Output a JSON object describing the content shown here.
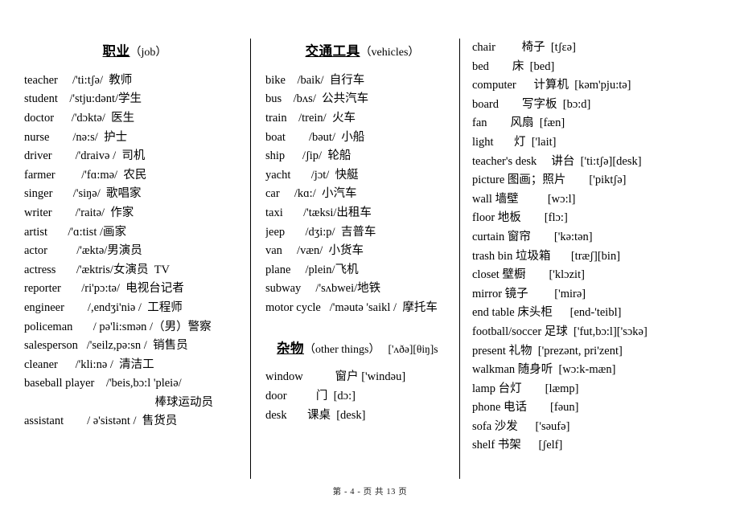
{
  "document": {
    "footer": "第 - 4 - 页 共 13 页"
  },
  "columns": {
    "jobs": {
      "heading_cn": "职业",
      "heading_en": "（job）",
      "entries": [
        "teacher     /'ti:tʃə/  教师",
        "student    /'stju:dənt/学生",
        "doctor      /'dɔktə/  医生",
        "nurse        /nə:s/  护士",
        "driver        /'draivə /  司机",
        "farmer         /'fɑ:mə/  农民",
        "singer       /'siŋə/  歌唱家",
        "writer        /'raitə/  作家",
        "artist       /'ɑ:tist /画家",
        "actor          /'æktə/男演员",
        "actress       /'æktris/女演员  TV",
        "reporter       /ri'pɔ:tə/  电视台记者",
        "engineer        /,endʒi'niə /  工程师",
        "policeman       / pə'li:smən /（男）警察",
        "salesperson   /'seilz,pə:sn /  销售员",
        "cleaner      /'kli:nə /  清洁工",
        "baseball player    /'beis,bɔ:l 'pleiə/"
      ],
      "continuation": "棒球运动员",
      "entries_after": [
        "assistant        / ə'sistənt /  售货员"
      ]
    },
    "vehicles": {
      "heading_cn": "交通工具",
      "heading_en": "（vehicles）",
      "entries": [
        "bike    /baik/  自行车",
        "bus    /bʌs/  公共汽车",
        "train    /trein/  火车",
        "boat        /bəut/  小船",
        "ship      /ʃip/  轮船",
        "yacht       /jɔt/  快艇",
        "car     /kɑ:/  小汽车",
        "taxi       /'tæksi/出租车",
        "jeep       /dʒi:p/  吉普车",
        "van     /væn/  小货车",
        "plane     /plein/飞机",
        "subway     /'sʌbwei/地铁",
        "motor cycle   /'məutə 'saikl /  摩托车"
      ]
    },
    "other_things": {
      "heading_cn": "杂物",
      "heading_en": "（other things）",
      "heading_ipa": "['ʌðə][θiŋ]s",
      "entries": [
        "window           窗户 ['windəu]",
        "door          门  [dɔ:]",
        "desk       课桌  [desk]"
      ]
    },
    "furniture": {
      "entries": [
        "chair         椅子  [tʃɛə]",
        "bed        床  [bed]",
        "computer      计算机  [kəm'pju:tə]",
        "board        写字板  [bɔ:d]",
        "fan        风扇  [fæn]",
        "light       灯  ['lait]",
        "teacher's desk     讲台  ['ti:tʃə][desk]",
        "picture 图画；照片        ['piktʃə]",
        "wall 墙壁          [wɔ:l]",
        "floor 地板        [flɔ:]",
        "curtain 窗帘        ['kə:tən]",
        "trash bin 垃圾箱       [træʃ][bin]",
        "closet 壁橱        ['klɔzit]",
        "mirror 镜子         ['mirə]",
        "end table 床头柜      [end-'teibl]",
        "football/soccer 足球  ['fut,bɔ:l]['sɔkə]",
        "present 礼物  ['prezənt, pri'zent]",
        "walkman 随身听  [wɔ:k-mæn]",
        "lamp 台灯        [læmp]",
        "phone 电话        [fəun]",
        "sofa 沙发      ['səufə]",
        "shelf 书架      [ʃelf]"
      ]
    }
  }
}
